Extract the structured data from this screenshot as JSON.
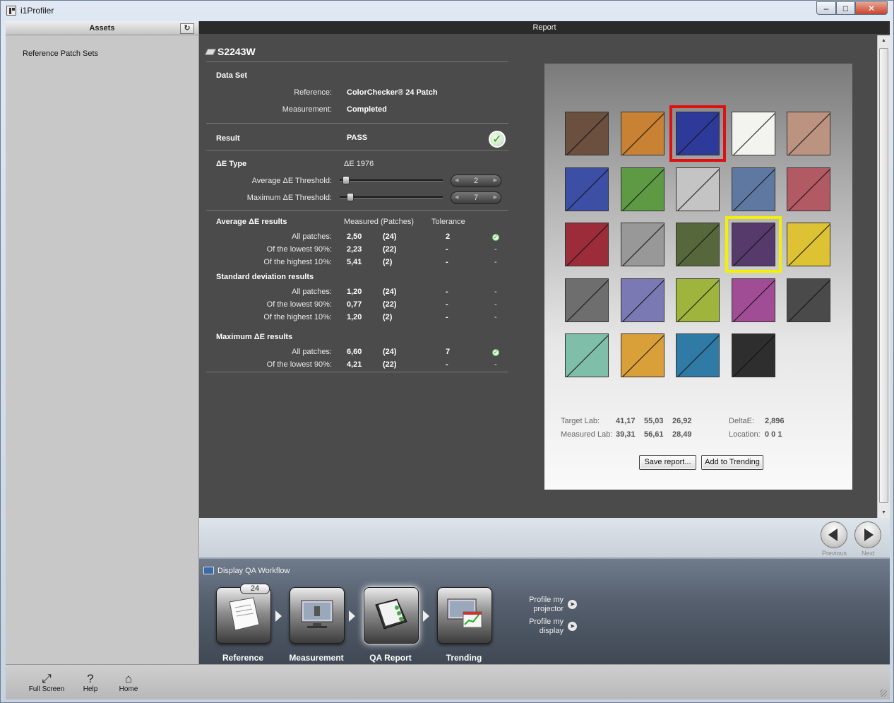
{
  "window": {
    "title": "i1Profiler"
  },
  "left_panel": {
    "header": "Assets",
    "items": [
      "Reference Patch Sets"
    ]
  },
  "report": {
    "header": "Report",
    "device_name": "S2243W",
    "data_set": {
      "heading": "Data Set",
      "reference_label": "Reference:",
      "reference_value": "ColorChecker® 24 Patch",
      "measurement_label": "Measurement:",
      "measurement_value": "Completed"
    },
    "result": {
      "label": "Result",
      "value": "PASS"
    },
    "delta_e_type": {
      "label": "ΔE Type",
      "value": "ΔE 1976",
      "avg_threshold_label": "Average  ΔE Threshold:",
      "avg_threshold_value": "2",
      "avg_threshold_fraction": 0.05,
      "max_threshold_label": "Maximum ΔE Threshold:",
      "max_threshold_value": "7",
      "max_threshold_fraction": 0.1
    },
    "avg_results": {
      "heading": "Average ΔE results",
      "col_measured": "Measured (Patches)",
      "col_tolerance": "Tolerance",
      "rows": [
        {
          "label": "All patches:",
          "measured": "2,50",
          "patches": "(24)",
          "tolerance": "2",
          "status": "check"
        },
        {
          "label": "Of the lowest 90%:",
          "measured": "2,23",
          "patches": "(22)",
          "tolerance": "-",
          "status": "-"
        },
        {
          "label": "Of the highest 10%:",
          "measured": "5,41",
          "patches": "(2)",
          "tolerance": "-",
          "status": "-"
        }
      ]
    },
    "std_results": {
      "heading": "Standard deviation results",
      "rows": [
        {
          "label": "All patches:",
          "measured": "1,20",
          "patches": "(24)",
          "tolerance": "-",
          "status": "-"
        },
        {
          "label": "Of the lowest 90%:",
          "measured": "0,77",
          "patches": "(22)",
          "tolerance": "-",
          "status": "-"
        },
        {
          "label": "Of the highest 10%:",
          "measured": "1,20",
          "patches": "(2)",
          "tolerance": "-",
          "status": "-"
        }
      ]
    },
    "max_results": {
      "heading": "Maximum ΔE results",
      "rows": [
        {
          "label": "All patches:",
          "measured": "6,60",
          "patches": "(24)",
          "tolerance": "7",
          "status": "check"
        },
        {
          "label": "Of the lowest 90%:",
          "measured": "4,21",
          "patches": "(22)",
          "tolerance": "-",
          "status": "-"
        }
      ]
    },
    "patch_info": {
      "target_label": "Target Lab:",
      "target_values": [
        "41,17",
        "55,03",
        "26,92"
      ],
      "measured_label": "Measured Lab:",
      "measured_values": [
        "39,31",
        "56,61",
        "28,49"
      ],
      "delta_label": "DeltaE:",
      "delta_value": "2,896",
      "location_label": "Location:",
      "location_value": "0 0 1"
    },
    "buttons": {
      "save": "Save report...",
      "trending": "Add to Trending"
    },
    "patches": [
      [
        "#6b4f3f",
        "#c98234",
        "#2e3a9a",
        "#f3f3ef",
        "#bb9380"
      ],
      [
        "#3c4fa5",
        "#5e9a43",
        "#c4c4c4",
        "#5f78a2",
        "#b25a63"
      ],
      [
        "#9c2c39",
        "#989898",
        "#55673b",
        "#553a6b",
        "#ddc233"
      ],
      [
        "#6e6e6e",
        "#7b79b4",
        "#9fb43c",
        "#a04d96",
        "#4a4a4a"
      ],
      [
        "#7fbea8",
        "#d9a03a",
        "#2f7ba6",
        "#2e2e2e"
      ]
    ],
    "selected_red": [
      0,
      2
    ],
    "selected_yellow": [
      2,
      3
    ]
  },
  "navigation": {
    "previous": "Previous",
    "next": "Next"
  },
  "workflow": {
    "title": "Display QA Workflow",
    "badge": "24",
    "steps": [
      "Reference",
      "Measurement",
      "QA Report",
      "Trending"
    ],
    "profile_projector": "Profile my projector",
    "profile_display": "Profile my display"
  },
  "bottom_bar": {
    "full_screen": "Full Screen",
    "help": "Help",
    "home": "Home"
  },
  "colors": {
    "accent_red": "#e01010",
    "accent_yellow": "#f4f000",
    "pass_green": "#2a9a2a"
  }
}
